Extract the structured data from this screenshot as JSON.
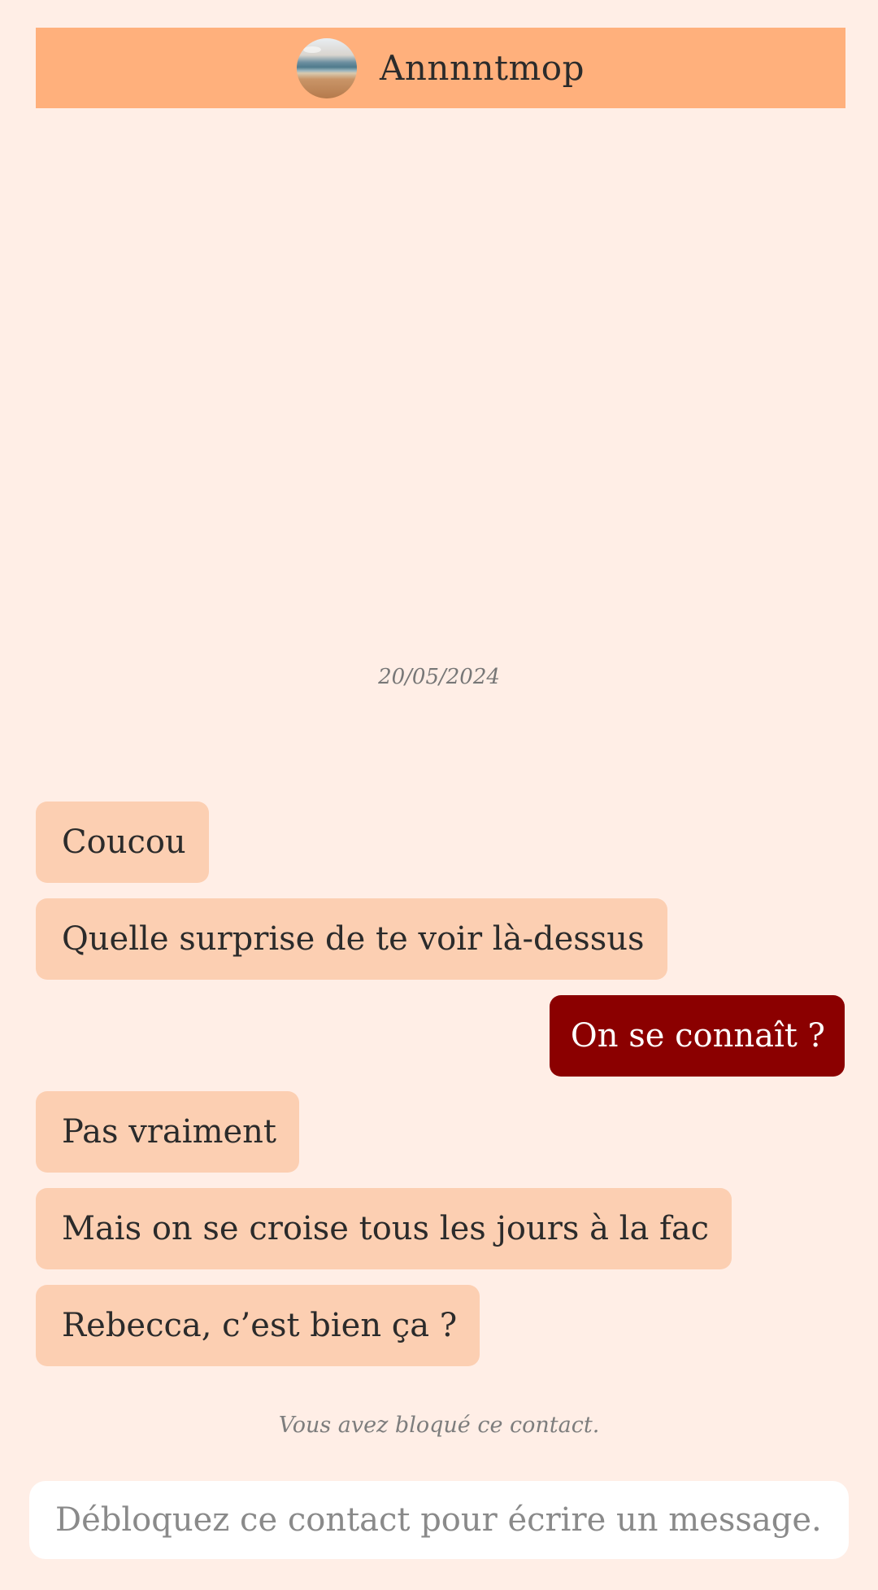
{
  "header": {
    "contact_name": "Annnntmop",
    "avatar_icon": "avatar-beach-photo",
    "background_color": "#ffb07c"
  },
  "conversation": {
    "date": "20/05/2024",
    "messages": [
      {
        "direction": "incoming",
        "text": "Coucou"
      },
      {
        "direction": "incoming",
        "text": "Quelle surprise de te voir là-dessus"
      },
      {
        "direction": "outgoing",
        "text": "On se connaît ?"
      },
      {
        "direction": "incoming",
        "text": "Pas vraiment"
      },
      {
        "direction": "incoming",
        "text": "Mais on se croise tous les jours à la fac"
      },
      {
        "direction": "incoming",
        "text": "Rebecca, c’est bien ça ?"
      }
    ],
    "blocked_note": "Vous avez bloqué ce contact."
  },
  "composer": {
    "placeholder": "Débloquez ce contact pour écrire un message."
  },
  "colors": {
    "page_background": "#ffeee6",
    "incoming_bubble": "#fccfb2",
    "outgoing_bubble": "#8b0000",
    "outgoing_text": "#ffffff"
  }
}
